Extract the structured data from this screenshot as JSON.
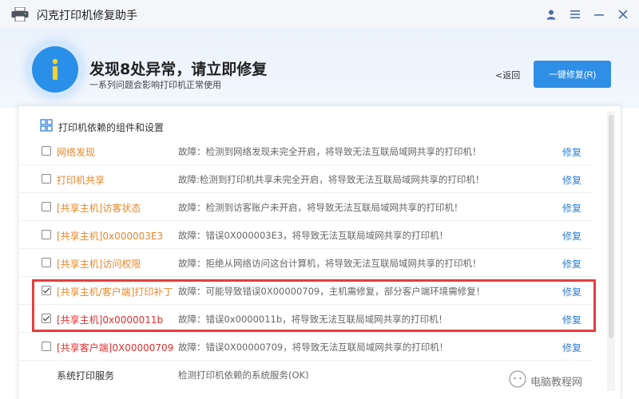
{
  "window": {
    "title": "闪克打印机修复助手"
  },
  "banner": {
    "title": "发现8处异常，请立即修复",
    "subtitle": "一系列问题会影响打印机正常使用",
    "back_label": "<返回",
    "fix_all_label": "一键修复(R)"
  },
  "section": {
    "title": "打印机依赖的组件和设置"
  },
  "rows": [
    {
      "name": "网络发现",
      "fault": "故障：检测到网络发现未完全开启，将导致无法互联局域网共享的打印机！",
      "fix": "修复",
      "checked": false,
      "color": "orange"
    },
    {
      "name": "打印机共享",
      "fault": "故障:检测到打印机共享未完全开启，将导致无法互联局域网共享的打印机！",
      "fix": "修复",
      "checked": false,
      "color": "orange"
    },
    {
      "name": "[共享主机]访客状态",
      "fault": "故障：检测到访客账户未开启，将导致无法互联局域网共享的打印机！",
      "fix": "修复",
      "checked": false,
      "color": "orange"
    },
    {
      "name": "[共享主机]0x000003E3",
      "fault": "故障：错误0X000003E3，将导致无法互联局域网共享的打印机！",
      "fix": "修复",
      "checked": false,
      "color": "orange"
    },
    {
      "name": "[共享主机]访问权限",
      "fault": "故障：拒绝从网络访问这台计算机，将导致无法互联局域网共享的打印机！",
      "fix": "修复",
      "checked": false,
      "color": "orange"
    },
    {
      "name": "[共享主机/客户端]打印补丁",
      "fault": "故障：可能导致错误0X00000709，主机需修复，部分客户端环境需修复！",
      "fix": "修复",
      "checked": true,
      "color": "orange"
    },
    {
      "name": "[共享主机]0x0000011b",
      "fault": "故障：错误0x0000011b，将导致无法互联局域网共享的打印机！",
      "fix": "修复",
      "checked": true,
      "color": "red"
    },
    {
      "name": "[共享客户端]0X00000709",
      "fault": "故障：错误0X00000709，将导致无法互联局域网共享的打印机！",
      "fix": "修复",
      "checked": false,
      "color": "red"
    },
    {
      "name": "系统打印服务",
      "fault": "检测打印机依赖的系统服务(OK)",
      "fix": "",
      "checked": null,
      "color": "dark"
    }
  ],
  "watermark": {
    "text": "电脑教程网"
  },
  "colors": {
    "accent": "#2f8ee6",
    "warning": "#e7872a",
    "error": "#e12d2d",
    "highlight": "#e63c3c",
    "link": "#2f7fd6"
  },
  "icons": [
    "printer-icon",
    "user-icon",
    "menu-icon",
    "minimize-icon",
    "close-icon",
    "info-icon",
    "grid-icon"
  ]
}
